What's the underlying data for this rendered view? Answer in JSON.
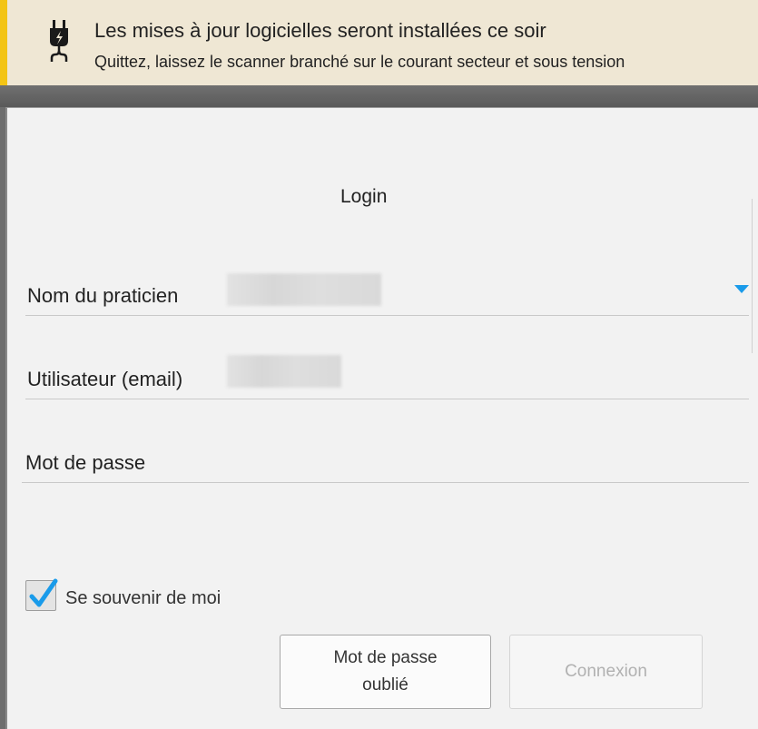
{
  "banner": {
    "title": "Les mises à jour logicielles seront installées ce soir",
    "subtitle": "Quittez, laissez le scanner branché sur le courant secteur et sous tension",
    "icon": "power-plug-icon",
    "accent_color": "#f3c414"
  },
  "dialog": {
    "title": "Login",
    "fields": {
      "practitioner": {
        "label": "Nom du praticien",
        "value_state": "obscured"
      },
      "user": {
        "label": "Utilisateur (email)",
        "value_state": "obscured"
      },
      "password": {
        "label": "Mot de passe"
      }
    },
    "remember_me": {
      "label": "Se souvenir de moi",
      "checked": true
    },
    "buttons": {
      "forgot_password": "Mot de passe oublié",
      "login": "Connexion",
      "login_enabled": false
    },
    "accent_color": "#1a9bea"
  }
}
